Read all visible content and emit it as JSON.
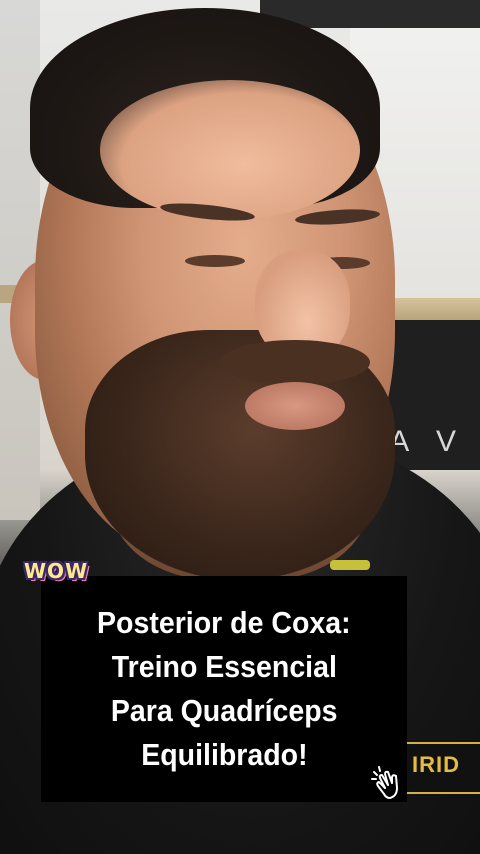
{
  "video": {
    "background_panel_letters": "A V",
    "shirt_brand": "IRID"
  },
  "overlay": {
    "sticker_text": "WOW",
    "caption_lines": [
      "Posterior de Coxa:",
      "Treino Essencial",
      "Para Quadríceps",
      "Equilibrado!"
    ],
    "sticker_icon": "clapping-hands-icon"
  },
  "colors": {
    "caption_bg": "#000000",
    "caption_text": "#ffffff",
    "brand_gold": "#e2bd3f"
  }
}
